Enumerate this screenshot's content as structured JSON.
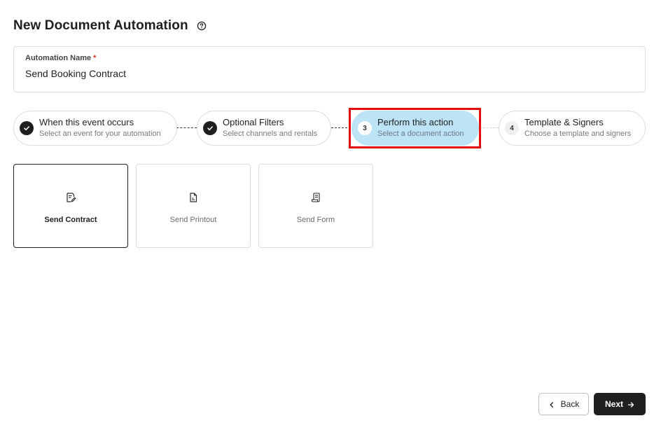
{
  "header": {
    "title": "New Document Automation",
    "help_icon": "help-circle-icon"
  },
  "automation_name": {
    "label": "Automation Name",
    "required_mark": "*",
    "value": "Send Booking Contract"
  },
  "steps": [
    {
      "title": "When this event occurs",
      "subtitle": "Select an event for your automation",
      "status": "completed",
      "icon": "check-icon"
    },
    {
      "title": "Optional Filters",
      "subtitle": "Select channels and rentals",
      "status": "completed",
      "icon": "check-icon"
    },
    {
      "number": "3",
      "title": "Perform this action",
      "subtitle": "Select a document action",
      "status": "current"
    },
    {
      "number": "4",
      "title": "Template & Signers",
      "subtitle": "Choose a template and signers",
      "status": "pending"
    }
  ],
  "actions": [
    {
      "label": "Send Contract",
      "icon": "contract-edit-icon",
      "selected": true
    },
    {
      "label": "Send Printout",
      "icon": "document-icon",
      "selected": false
    },
    {
      "label": "Send Form",
      "icon": "form-icon",
      "selected": false
    }
  ],
  "footer": {
    "back_label": "Back",
    "next_label": "Next"
  },
  "colors": {
    "active_step": "#bde3f7",
    "highlight": "#e30b0b",
    "primary": "#1f1f1f"
  }
}
